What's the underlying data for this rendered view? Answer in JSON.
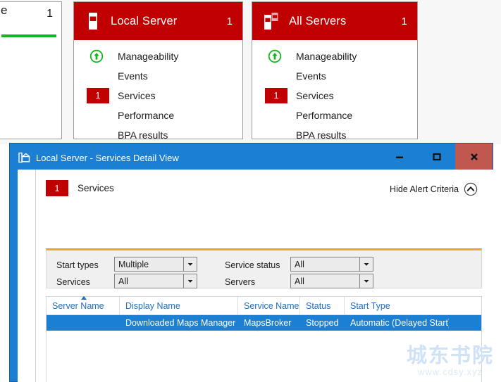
{
  "dashboard": {
    "partial_tile": {
      "letter": "e",
      "count": "1"
    },
    "tiles": [
      {
        "title": "Local Server",
        "count": "1",
        "icon": "server-icon",
        "rows": [
          {
            "label": "Manageability",
            "badge": "",
            "icon": "manageability-up-arrow-icon"
          },
          {
            "label": "Events",
            "badge": "",
            "icon": ""
          },
          {
            "label": "Services",
            "badge": "1",
            "icon": ""
          },
          {
            "label": "Performance",
            "badge": "",
            "icon": ""
          },
          {
            "label": "BPA results",
            "badge": "",
            "icon": ""
          }
        ]
      },
      {
        "title": "All Servers",
        "count": "1",
        "icon": "all-servers-icon",
        "rows": [
          {
            "label": "Manageability",
            "badge": "",
            "icon": "manageability-up-arrow-icon"
          },
          {
            "label": "Events",
            "badge": "",
            "icon": ""
          },
          {
            "label": "Services",
            "badge": "1",
            "icon": ""
          },
          {
            "label": "Performance",
            "badge": "",
            "icon": ""
          },
          {
            "label": "BPA results",
            "badge": "",
            "icon": ""
          }
        ]
      }
    ]
  },
  "dialog": {
    "title": "Local Server - Services Detail View",
    "icon": "detail-view-icon",
    "window_buttons": {
      "minimize": "minimize-icon",
      "maximize": "maximize-icon",
      "close": "close-icon"
    },
    "header": {
      "badge": "1",
      "label": "Services",
      "toggle_label": "Hide Alert Criteria",
      "toggle_icon": "chevron-up-circle-icon"
    },
    "filters": [
      {
        "label": "Start types",
        "value": "Multiple"
      },
      {
        "label": "Services",
        "value": "All"
      },
      {
        "label": "Service status",
        "value": "All"
      },
      {
        "label": "Servers",
        "value": "All"
      }
    ],
    "table": {
      "columns": [
        "Server Name",
        "Display Name",
        "Service Name",
        "Status",
        "Start Type"
      ],
      "sorted_column": "Server Name",
      "sort_direction": "ascending",
      "rows": [
        {
          "server_name": "",
          "display_name": "Downloaded Maps Manager",
          "service_name": "MapsBroker",
          "status": "Stopped",
          "start_type": "Automatic (Delayed Start)",
          "selected": true
        }
      ]
    }
  },
  "watermark": {
    "text_cn": "城东书院",
    "url": "www.cdsy.xyz"
  },
  "colors": {
    "alert_red": "#c00000",
    "window_blue": "#1b7fd4",
    "close_red": "#c1584f",
    "criteria_orange": "#f0a32c",
    "ok_green": "#16b520",
    "header_link_blue": "#1f6fc4"
  }
}
